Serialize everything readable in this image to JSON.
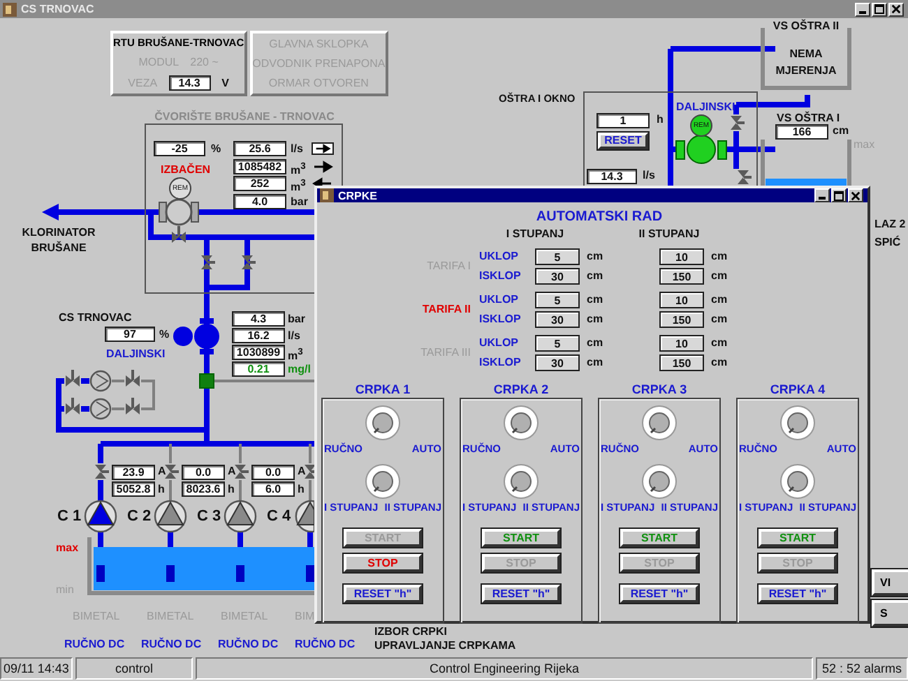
{
  "window": {
    "title": "CS TRNOVAC"
  },
  "rtu": {
    "title": "RTU BRUŠANE-TRNOVAC",
    "modul_label": "MODUL",
    "modul_value": "220 ~",
    "veza_label": "VEZA",
    "veza_value": "14.3",
    "veza_unit": "V",
    "signals": [
      {
        "label": "GLAVNA SKLOPKA",
        "active": false
      },
      {
        "label": "ODVODNIK PRENAPONA",
        "active": false
      },
      {
        "label": "ORMAR OTVOREN",
        "active": false
      }
    ]
  },
  "node": {
    "title": "ČVORIŠTE BRUŠANE - TRNOVAC",
    "valve_value": "-25",
    "valve_unit": "%",
    "status": "IZBAČEN",
    "badge": "REM",
    "readings": [
      {
        "value": "25.6",
        "unit": "l/s",
        "kind": "boxed_right"
      },
      {
        "value": "1085482",
        "unit": "m$^{3}$",
        "kind": "right"
      },
      {
        "value": "252",
        "unit": "m$^{3}$",
        "kind": "left"
      },
      {
        "value": "4.0",
        "unit": "bar",
        "kind": "plain"
      }
    ]
  },
  "klorinator": {
    "label": "KLORINATOR BRUŠANE"
  },
  "cs": {
    "title": "CS TRNOVAC",
    "value": "97",
    "unit": "%",
    "mode": "DALJINSKI",
    "readings": [
      {
        "value": "4.3",
        "unit": "bar",
        "kind": "normal"
      },
      {
        "value": "16.2",
        "unit": "l/s",
        "kind": "normal"
      },
      {
        "value": "1030899",
        "unit": "m$^{3}$",
        "kind": "normal"
      },
      {
        "value": "0.21",
        "unit": "mg/l",
        "kind": "chlorine"
      }
    ]
  },
  "pumps": [
    {
      "label": "C 1",
      "running": true,
      "current": "23.9",
      "current_unit": "A",
      "hours": "5052.8",
      "hours_unit": "h",
      "bimetal": "BIMETAL",
      "mode": "RUČNO DC"
    },
    {
      "label": "C 2",
      "running": false,
      "current": "0.0",
      "current_unit": "A",
      "hours": "8023.6",
      "hours_unit": "h",
      "bimetal": "BIMETAL",
      "mode": "RUČNO DC"
    },
    {
      "label": "C 3",
      "running": false,
      "current": "0.0",
      "current_unit": "A",
      "hours": "6.0",
      "hours_unit": "h",
      "bimetal": "BIMETAL",
      "mode": "RUČNO DC"
    },
    {
      "label": "C 4",
      "running": false,
      "bimetal": "BIM",
      "mode": "RUČNO DC"
    }
  ],
  "tank": {
    "max_label": "max",
    "min_label": "min"
  },
  "ostra_ii": {
    "title": "VS OŠTRA II",
    "status": "NEMA MJERENJA"
  },
  "okno": {
    "title": "OŠTRA I OKNO",
    "hours": "1",
    "hours_unit": "h",
    "reset": "RESET",
    "flow": "14.3",
    "flow_unit": "l/s",
    "mode": "DALJINSKI",
    "badge": "REM",
    "running": true
  },
  "ostra_i": {
    "title": "VS OŠTRA I",
    "value": "166",
    "unit": "cm",
    "max_label": "max"
  },
  "edge_labels": [
    "LAZ 2",
    "SPIĆ"
  ],
  "edge_buttons": [
    "VI",
    "S"
  ],
  "control_labels": [
    "IZBOR CRPKI",
    "UPRAVLJANJE CRPKAMA"
  ],
  "popup": {
    "title": "CRPKE",
    "heading": "AUTOMATSKI RAD",
    "columns": [
      "I STUPANJ",
      "II STUPANJ"
    ],
    "tariffs": [
      {
        "label": "TARIFA I",
        "selected": false,
        "rows": [
          {
            "label": "UKLOP",
            "stage1": "5",
            "unit1": "cm",
            "stage2": "10",
            "unit2": "cm"
          },
          {
            "label": "ISKLOP",
            "stage1": "30",
            "unit1": "cm",
            "stage2": "150",
            "unit2": "cm"
          }
        ]
      },
      {
        "label": "TARIFA II",
        "selected": true,
        "rows": [
          {
            "label": "UKLOP",
            "stage1": "5",
            "unit1": "cm",
            "stage2": "10",
            "unit2": "cm"
          },
          {
            "label": "ISKLOP",
            "stage1": "30",
            "unit1": "cm",
            "stage2": "150",
            "unit2": "cm"
          }
        ]
      },
      {
        "label": "TARIFA III",
        "selected": false,
        "rows": [
          {
            "label": "UKLOP",
            "stage1": "5",
            "unit1": "cm",
            "stage2": "10",
            "unit2": "cm"
          },
          {
            "label": "ISKLOP",
            "stage1": "30",
            "unit1": "cm",
            "stage2": "150",
            "unit2": "cm"
          }
        ]
      }
    ],
    "pumps": [
      {
        "title": "CRPKA 1",
        "mode_left": "RUČNO",
        "mode_right": "AUTO",
        "stage_left": "I STUPANJ",
        "stage_right": "II STUPANJ",
        "start": "START",
        "stop": "STOP",
        "reset": "RESET \"h\"",
        "running": true
      },
      {
        "title": "CRPKA 2",
        "mode_left": "RUČNO",
        "mode_right": "AUTO",
        "stage_left": "I STUPANJ",
        "stage_right": "II STUPANJ",
        "start": "START",
        "stop": "STOP",
        "reset": "RESET \"h\"",
        "running": false
      },
      {
        "title": "CRPKA 3",
        "mode_left": "RUČNO",
        "mode_right": "AUTO",
        "stage_left": "I STUPANJ",
        "stage_right": "II STUPANJ",
        "start": "START",
        "stop": "STOP",
        "reset": "RESET \"h\"",
        "running": false
      },
      {
        "title": "CRPKA 4",
        "mode_left": "RUČNO",
        "mode_right": "AUTO",
        "stage_left": "I STUPANJ",
        "stage_right": "II STUPANJ",
        "start": "START",
        "stop": "STOP",
        "reset": "RESET \"h\"",
        "running": false
      }
    ]
  },
  "status_bar": [
    "09/11 14:43",
    "control",
    "Control Engineering Rijeka",
    "52 : 52 alarms"
  ]
}
